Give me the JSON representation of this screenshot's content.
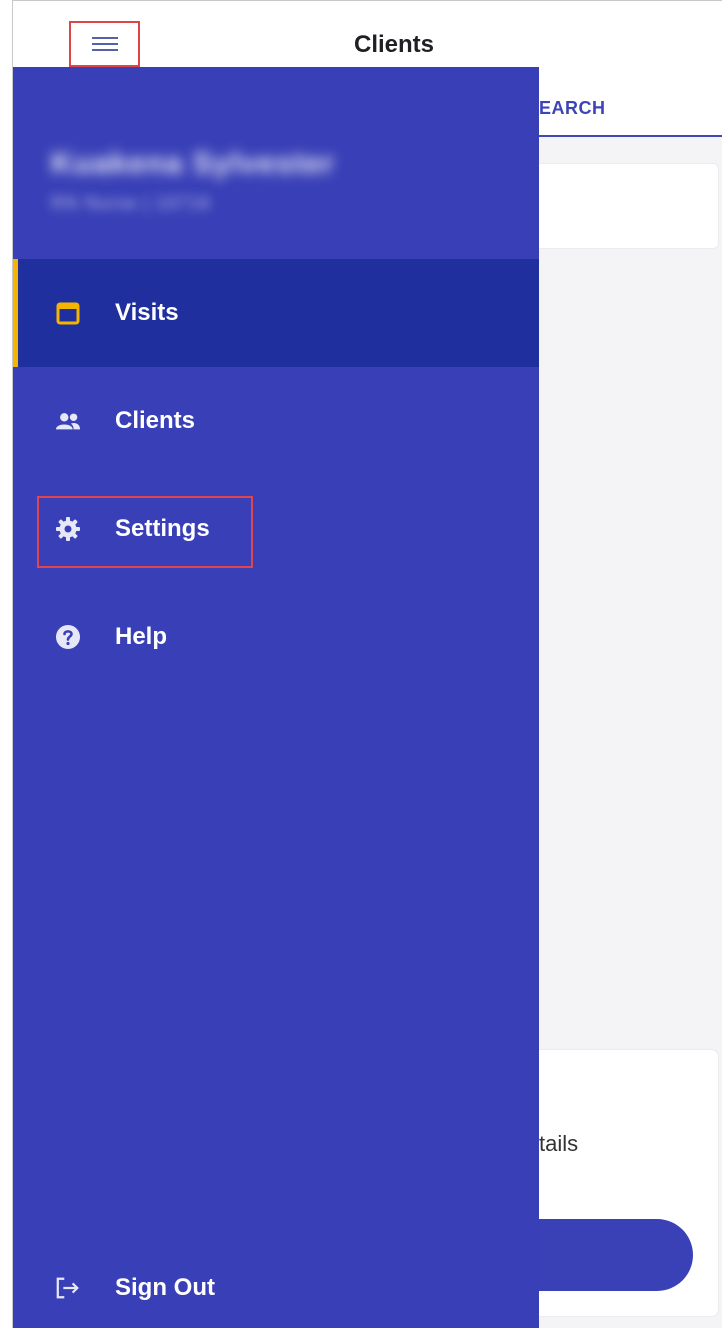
{
  "header": {
    "title": "Clients",
    "menu_icon": "hamburger-menu-icon"
  },
  "tabs": {
    "visible_partial_label": "EARCH"
  },
  "background_content": {
    "card_text_partial": "tails"
  },
  "drawer": {
    "profile": {
      "name": "Kuakena Sylvester",
      "subtitle": "RN Nurse | 10716"
    },
    "items": [
      {
        "label": "Visits",
        "icon": "calendar-icon",
        "active": true
      },
      {
        "label": "Clients",
        "icon": "people-icon",
        "active": false
      },
      {
        "label": "Settings",
        "icon": "gear-icon",
        "active": false,
        "highlighted": true
      },
      {
        "label": "Help",
        "icon": "help-circle-icon",
        "active": false
      }
    ],
    "sign_out": {
      "label": "Sign Out",
      "icon": "sign-out-icon"
    }
  },
  "colors": {
    "drawer_bg": "#3940b7",
    "active_item_bg": "#1f2f9e",
    "active_indicator": "#f4b400",
    "highlight_border": "#e0454e",
    "accent": "#3d44b6"
  }
}
